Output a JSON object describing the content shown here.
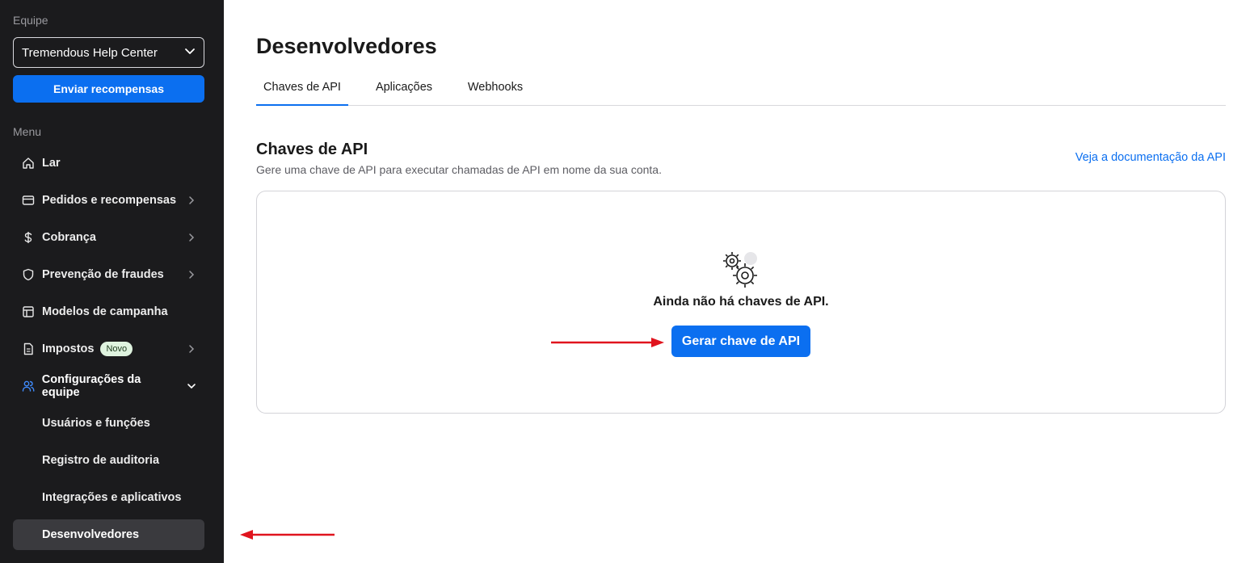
{
  "sidebar": {
    "team_label": "Equipe",
    "team_select_value": "Tremendous Help Center",
    "send_rewards_label": "Enviar recompensas",
    "menu_label": "Menu",
    "items": [
      {
        "label": "Lar",
        "icon": "home-icon"
      },
      {
        "label": "Pedidos e recompensas",
        "icon": "card-icon"
      },
      {
        "label": "Cobrança",
        "icon": "dollar-icon"
      },
      {
        "label": "Prevenção de fraudes",
        "icon": "shield-icon"
      },
      {
        "label": "Modelos de campanha",
        "icon": "layout-icon"
      },
      {
        "label": "Impostos",
        "icon": "document-icon",
        "badge": "Novo"
      },
      {
        "label": "Configurações da equipe",
        "icon": "users-icon"
      }
    ],
    "subitems": [
      {
        "label": "Usuários e funções"
      },
      {
        "label": "Registro de auditoria"
      },
      {
        "label": "Integrações e aplicativos"
      },
      {
        "label": "Desenvolvedores"
      }
    ]
  },
  "main": {
    "title": "Desenvolvedores",
    "tabs": [
      {
        "label": "Chaves de API"
      },
      {
        "label": "Aplicações"
      },
      {
        "label": "Webhooks"
      }
    ],
    "section_title": "Chaves de API",
    "section_subtitle": "Gere uma chave de API para executar chamadas de API em nome da sua conta.",
    "docs_link": "Veja a documentação da API",
    "empty_state_text": "Ainda não há chaves de API.",
    "generate_button": "Gerar chave de API"
  },
  "colors": {
    "accent": "#0b6ff0",
    "sidebar_bg": "#1b1b1d",
    "annotation_arrow": "#e0141e"
  }
}
